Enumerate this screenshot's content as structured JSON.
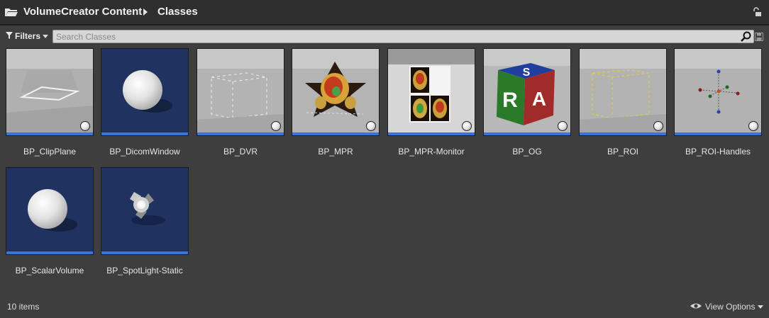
{
  "breadcrumb": {
    "root": "VolumeCreator Content",
    "current": "Classes"
  },
  "filter_bar": {
    "filters_label": "Filters",
    "search_placeholder": "Search Classes"
  },
  "assets": [
    {
      "name": "BP_ClipPlane"
    },
    {
      "name": "BP_DicomWindow"
    },
    {
      "name": "BP_DVR"
    },
    {
      "name": "BP_MPR"
    },
    {
      "name": "BP_MPR-Monitor"
    },
    {
      "name": "BP_OG"
    },
    {
      "name": "BP_ROI"
    },
    {
      "name": "BP_ROI-Handles"
    },
    {
      "name": "BP_ScalarVolume"
    },
    {
      "name": "BP_SpotLight-Static"
    }
  ],
  "og_cube": {
    "top": "S",
    "front": "R",
    "side": "A"
  },
  "footer": {
    "item_count": "10 items",
    "view_options": "View Options"
  },
  "colors": {
    "header_bg": "#2f2f2f",
    "panel_bg": "#3e3e3e",
    "asset_bar": "#3b74d8",
    "thumb_blue_bg": "#1f3260"
  },
  "icons": [
    "folder-icon",
    "breadcrumb-arrow-icon",
    "lock-icon",
    "filter-icon",
    "search-icon",
    "save-search-icon",
    "eye-icon"
  ]
}
